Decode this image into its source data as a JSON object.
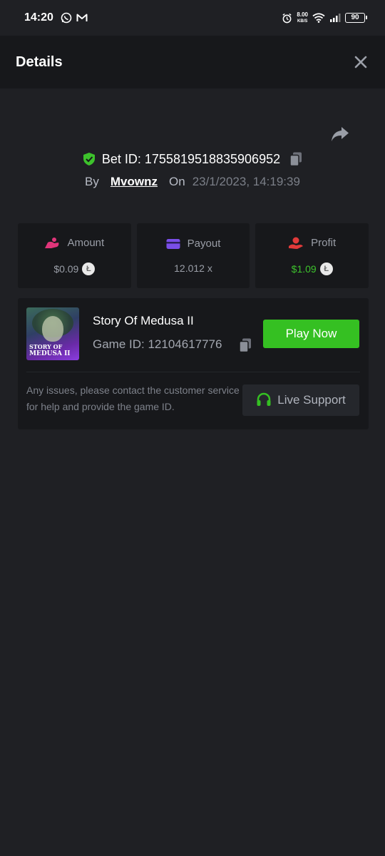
{
  "statusbar": {
    "time": "14:20",
    "speed_value": "8.00",
    "speed_unit": "KB/S",
    "battery": "90"
  },
  "header": {
    "title": "Details"
  },
  "bet": {
    "id_label": "Bet ID: 1755819518835906952",
    "by_label": "By",
    "username": "Mvownz",
    "on_label": "On",
    "datetime": "23/1/2023, 14:19:39"
  },
  "stats": {
    "amount": {
      "label": "Amount",
      "value": "$0.09"
    },
    "payout": {
      "label": "Payout",
      "value": "12.012 x"
    },
    "profit": {
      "label": "Profit",
      "value": "$1.09"
    }
  },
  "game": {
    "thumb_title_1": "STORY OF",
    "thumb_title_2": "MEDUSA II",
    "name": "Story Of Medusa II",
    "id_label": "Game ID: 12104617776",
    "play_label": "Play Now",
    "issues_text": "Any issues, please contact the customer service for help and provide the game ID.",
    "support_label": "Live Support"
  },
  "colors": {
    "accent_green": "#35c022",
    "profit_green": "#3dc22c",
    "amount_icon": "#e0357a",
    "payout_icon": "#7a4ee8",
    "profit_icon": "#e03a3a"
  },
  "icons": [
    "whatsapp-icon",
    "gmail-icon",
    "alarm-icon",
    "wifi-icon",
    "signal-icon",
    "battery-icon",
    "close-icon",
    "share-icon",
    "shield-check-icon",
    "copy-icon",
    "amount-icon",
    "payout-card-icon",
    "profit-hand-icon",
    "coin-icon",
    "headset-icon"
  ]
}
